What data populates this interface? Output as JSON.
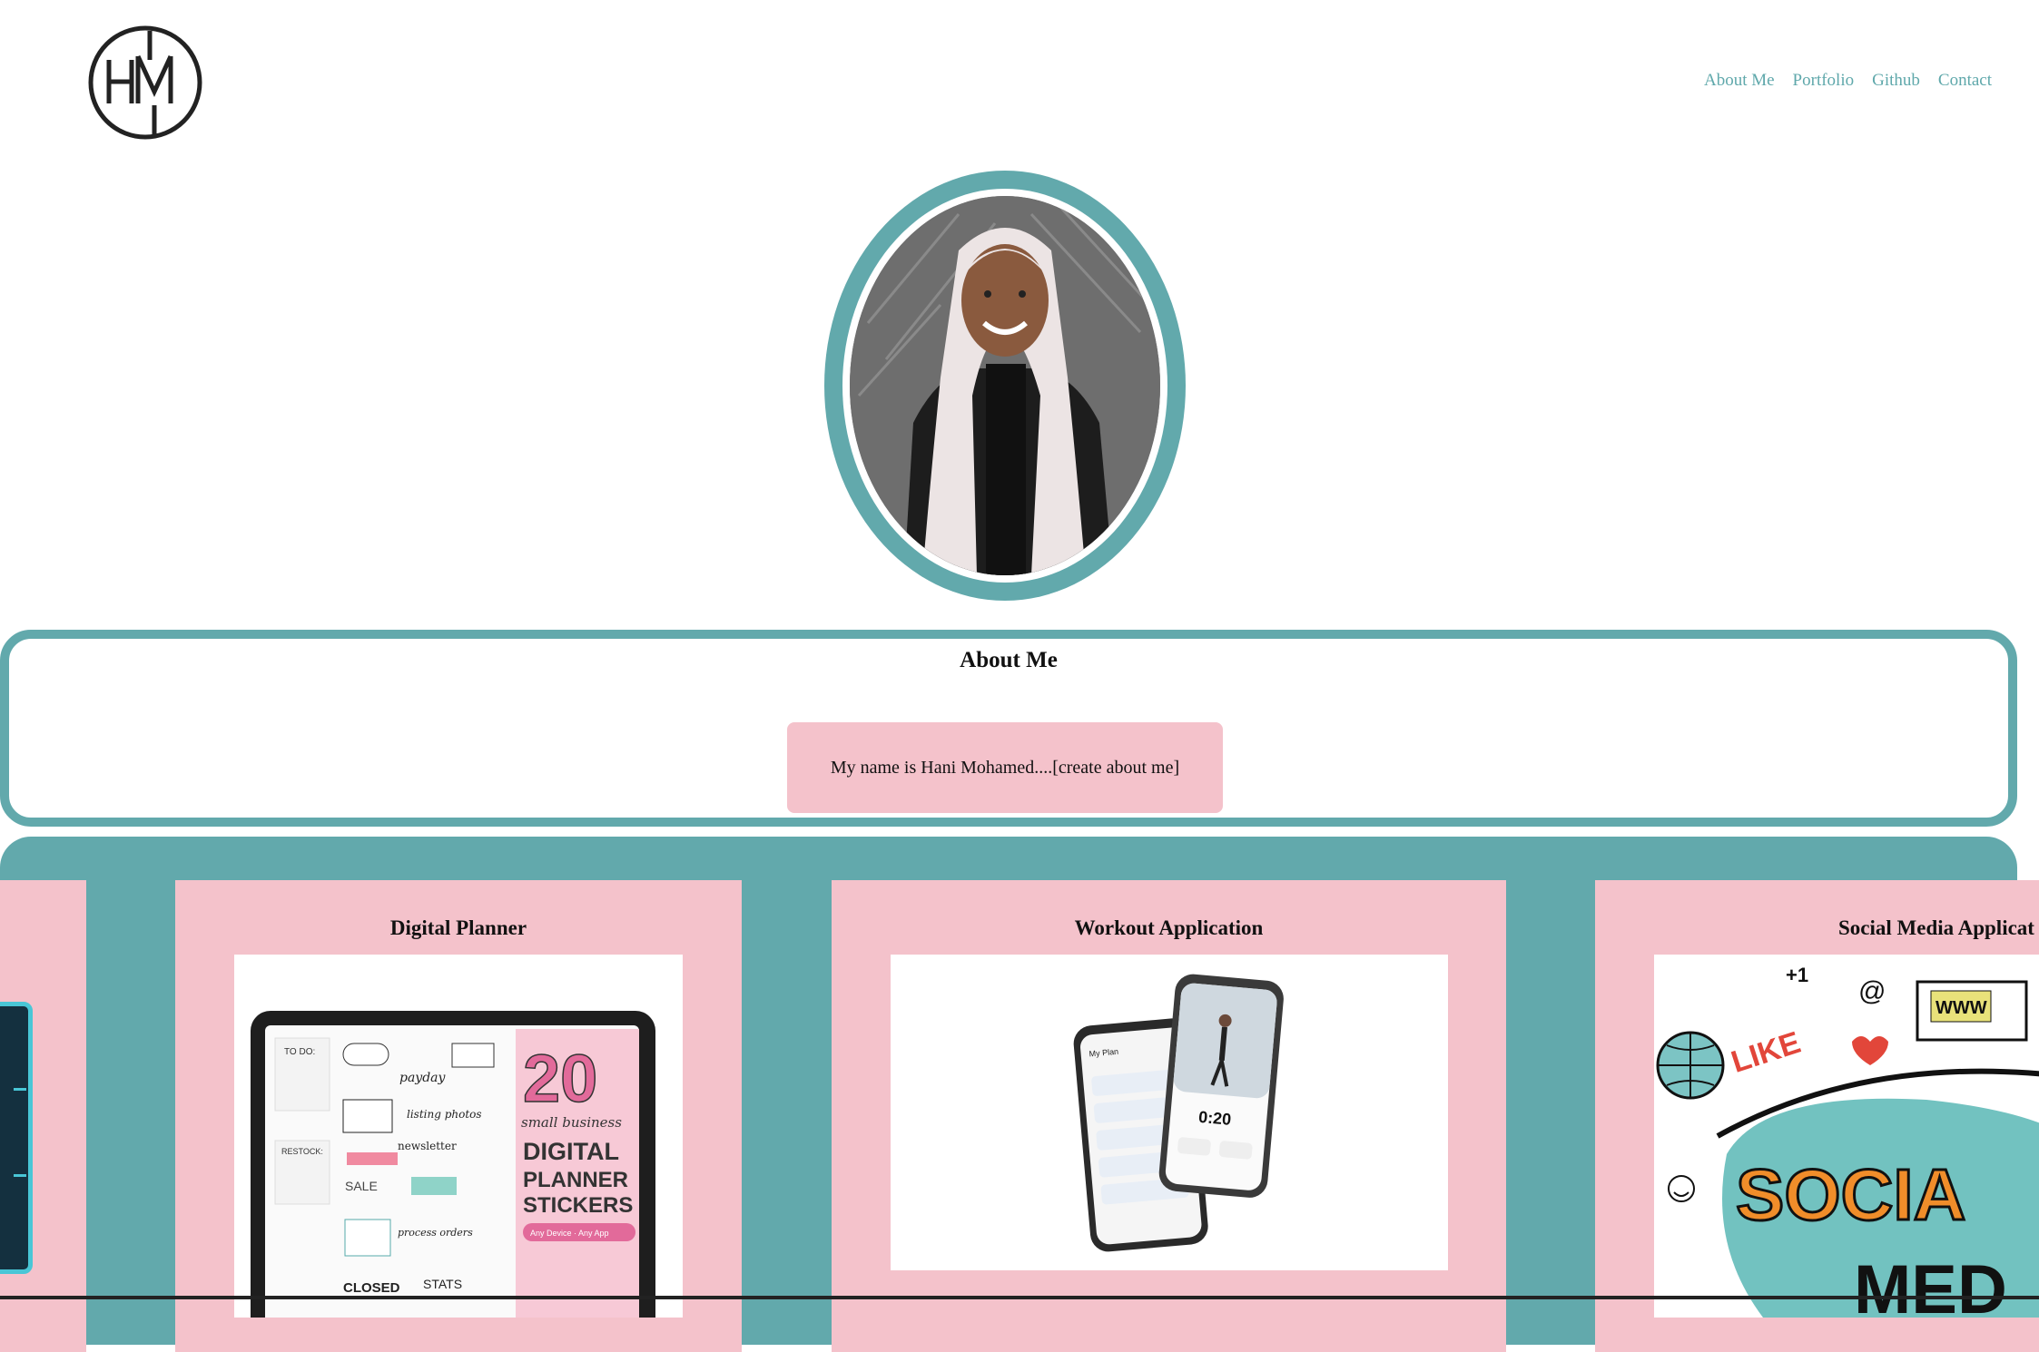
{
  "header": {
    "logo_text": "HM",
    "nav": [
      "About Me",
      "Portfolio",
      "Github",
      "Contact"
    ]
  },
  "about": {
    "title": "About Me",
    "body": "My name is Hani Mohamed....[create about me]"
  },
  "portfolio": {
    "cards": [
      {
        "title": "Digital Planner",
        "image_words": [
          "20",
          "small business",
          "DIGITAL",
          "PLANNER",
          "STICKERS",
          "Any Device · Any App"
        ]
      },
      {
        "title": "Workout Application",
        "image_words": [
          "0:20"
        ]
      },
      {
        "title": "Social Media Applicat",
        "image_words": [
          "LIKE",
          "+1",
          "@",
          "WWW",
          "SOCIA",
          "MED"
        ]
      }
    ]
  },
  "colors": {
    "teal": "#62a9ac",
    "pink": "#f4c2cb",
    "nav_text": "#5fa8ab"
  }
}
